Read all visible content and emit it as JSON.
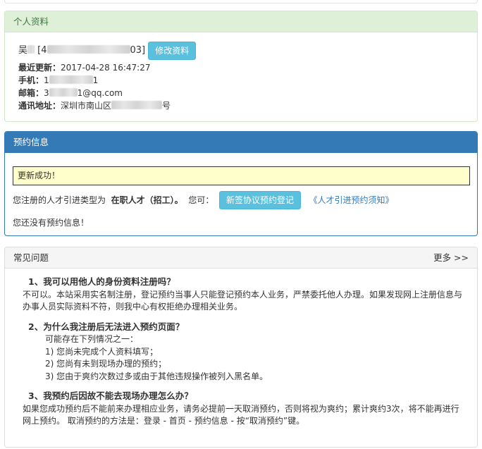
{
  "profile": {
    "heading": "个人资料",
    "name_visible": "吴",
    "id_prefix": "[4",
    "id_suffix": "03]",
    "edit_button": "修改资料",
    "last_update_label": "最近更新：",
    "last_update_value": "2017-04-28 16:47:27",
    "phone_label": "手机：",
    "phone_prefix": "1",
    "phone_suffix": "1",
    "email_label": "邮箱：",
    "email_prefix": "3",
    "email_suffix": "1@qq.com",
    "address_label": "通讯地址：",
    "address_visible": "深圳市南山区",
    "address_suffix": "号"
  },
  "reservation": {
    "heading": "预约信息",
    "alert": "更新成功！",
    "type_prefix": "您注册的人才引进类型为",
    "type_value": "在职人才（招工）。",
    "can_label": "您可：",
    "new_button": "新签协议预约登记",
    "notice_link": "《人才引进预约须知》",
    "no_reservation": "您还没有预约信息！"
  },
  "faq": {
    "heading": "常见问题",
    "more": "更多 >>",
    "items": [
      {
        "q": "1、我可以用他人的身份资料注册吗？",
        "a": "不可以。本站采用实名制注册，登记预约当事人只能登记预约本人业务，严禁委托他人办理。如果发现网上注册信息与办事人员实际资料不符，则我中心有权拒绝办理相关业务。"
      },
      {
        "q": "2、为什么我注册后无法进入预约页面？",
        "intro": "可能存在下列情况之一：",
        "subs": [
          "1) 您尚未完成个人资料填写；",
          "2) 您尚有未到现场办理的预约；",
          "3) 您由于爽约次数过多或由于其他违规操作被列入黑名单。"
        ]
      },
      {
        "q": "3、我预约后因故不能去现场办理怎么办？",
        "a": "如果您成功预约后不能前来办理相应业务，请务必提前一天取消预约，否则将视为爽约；累计爽约3次，将不能再进行网上预约。 取消预约的方法是：登录 - 首页 - 预约信息 - 按“取消预约”键。"
      }
    ]
  }
}
